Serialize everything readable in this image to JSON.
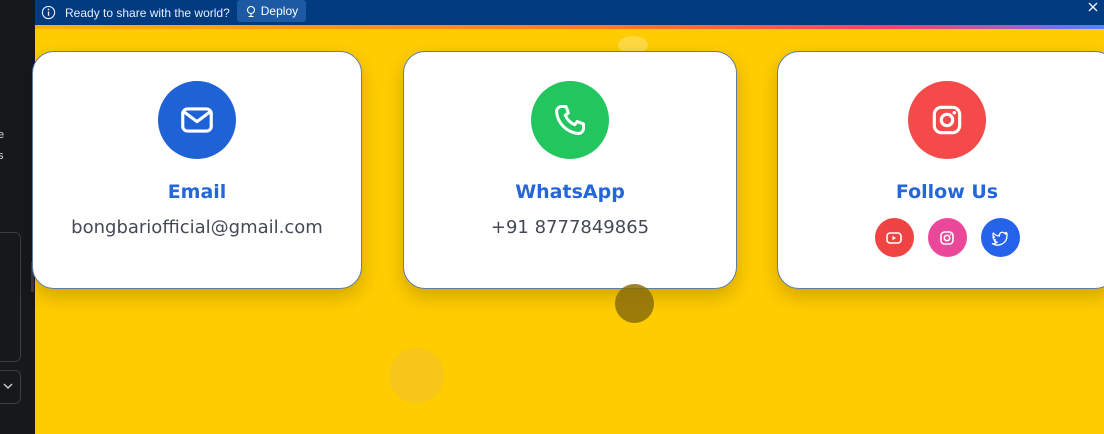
{
  "sidebar_fragments": [
    "e",
    "s"
  ],
  "banner": {
    "message": "Ready to share with the world?",
    "deploy_label": "Deploy"
  },
  "cards": {
    "email": {
      "title": "Email",
      "value": "bongbariofficial@gmail.com",
      "icon": "mail-icon",
      "color": "#1f62d6"
    },
    "whatsapp": {
      "title": "WhatsApp",
      "value": "+91 8777849865",
      "icon": "phone-icon",
      "color": "#22c55e"
    },
    "follow": {
      "title": "Follow Us",
      "icon": "instagram-icon",
      "color": "#f44a4a",
      "socials": [
        {
          "name": "youtube-icon",
          "color": "#ef4444"
        },
        {
          "name": "instagram-icon",
          "color": "#ec4899"
        },
        {
          "name": "twitter-icon",
          "color": "#2563eb"
        }
      ]
    }
  },
  "colors": {
    "page_background": "#ffcc00",
    "banner_background": "#003b80",
    "title_blue": "#2566d8"
  }
}
